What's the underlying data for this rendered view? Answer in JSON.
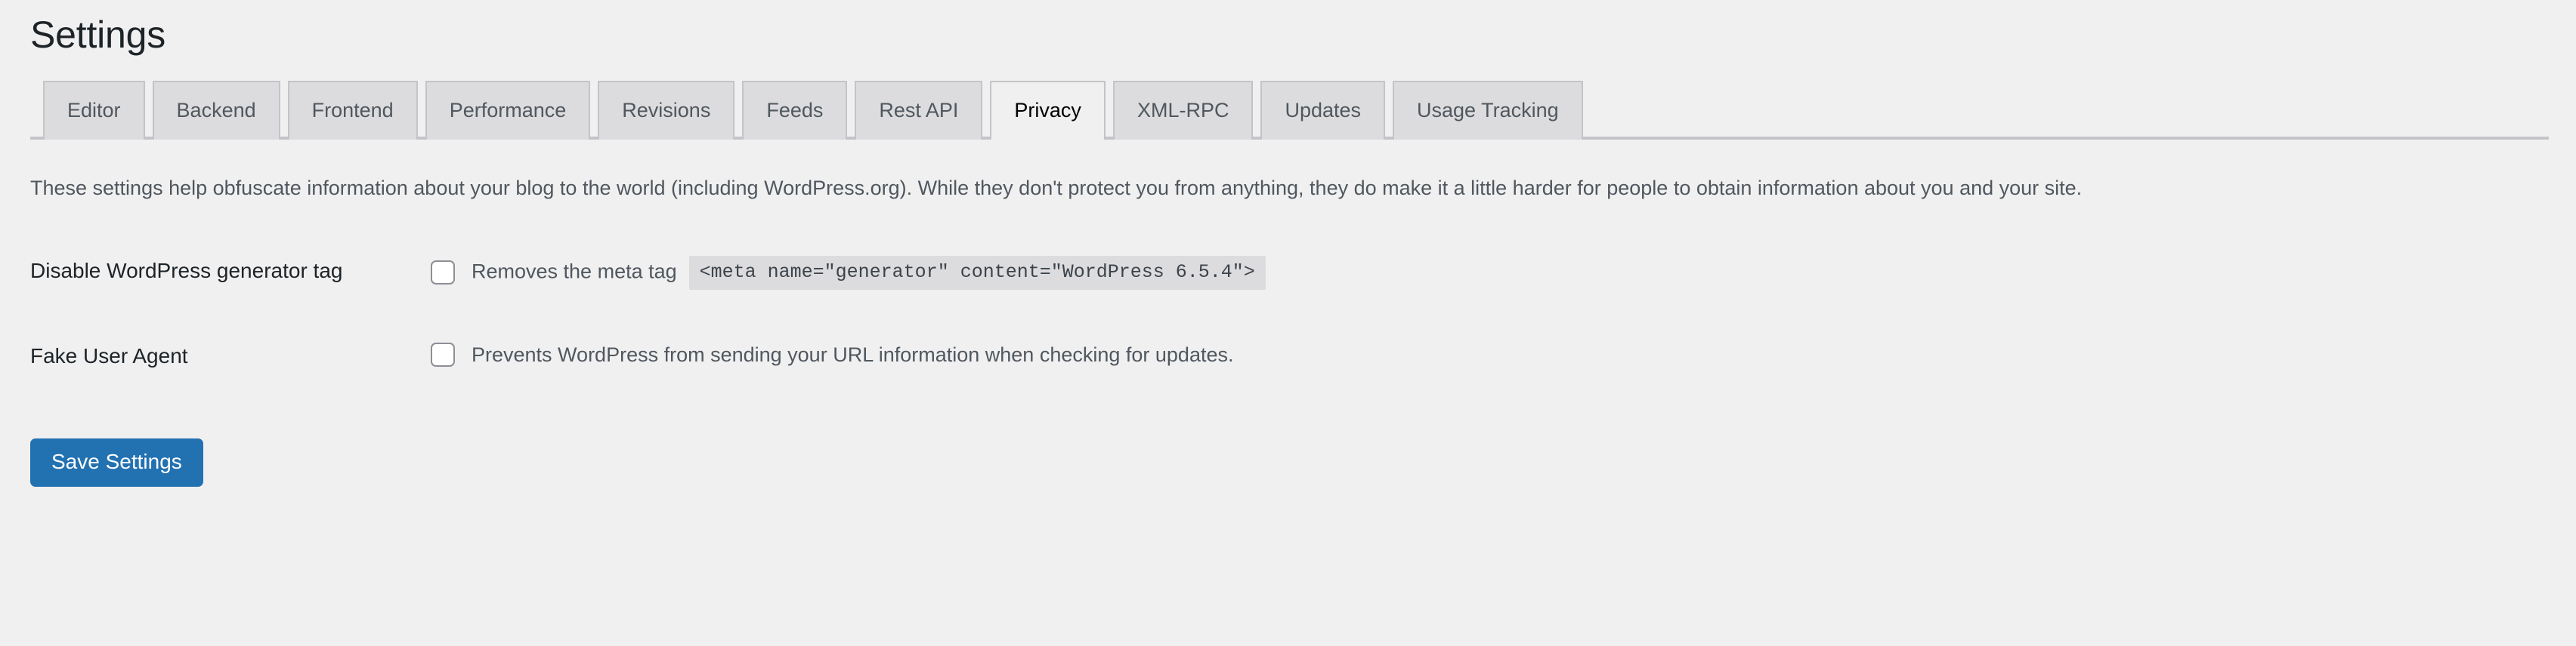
{
  "page": {
    "title": "Settings",
    "background_color": "#f0f0f1"
  },
  "tabs": {
    "active": "Privacy",
    "items": [
      {
        "label": "Editor",
        "active": false
      },
      {
        "label": "Backend",
        "active": false
      },
      {
        "label": "Frontend",
        "active": false
      },
      {
        "label": "Performance",
        "active": false
      },
      {
        "label": "Revisions",
        "active": false
      },
      {
        "label": "Feeds",
        "active": false
      },
      {
        "label": "Rest API",
        "active": false
      },
      {
        "label": "Privacy",
        "active": true
      },
      {
        "label": "XML-RPC",
        "active": false
      },
      {
        "label": "Updates",
        "active": false
      },
      {
        "label": "Usage Tracking",
        "active": false
      }
    ]
  },
  "main": {
    "description": "These settings help obfuscate information about your blog to the world (including WordPress.org). While they don't protect you from anything, they do make it a little harder for people to obtain information about you and your site.",
    "settings": [
      {
        "label": "Disable WordPress generator tag",
        "checkbox_checked": false,
        "field_text": "Removes the meta tag",
        "code": "<meta name=\"generator\" content=\"WordPress 6.5.4\">"
      },
      {
        "label": "Fake User Agent",
        "checkbox_checked": false,
        "field_text": "Prevents WordPress from sending your URL information when checking for updates.",
        "code": ""
      }
    ],
    "save_label": "Save Settings",
    "accent_color": "#2271b1"
  }
}
